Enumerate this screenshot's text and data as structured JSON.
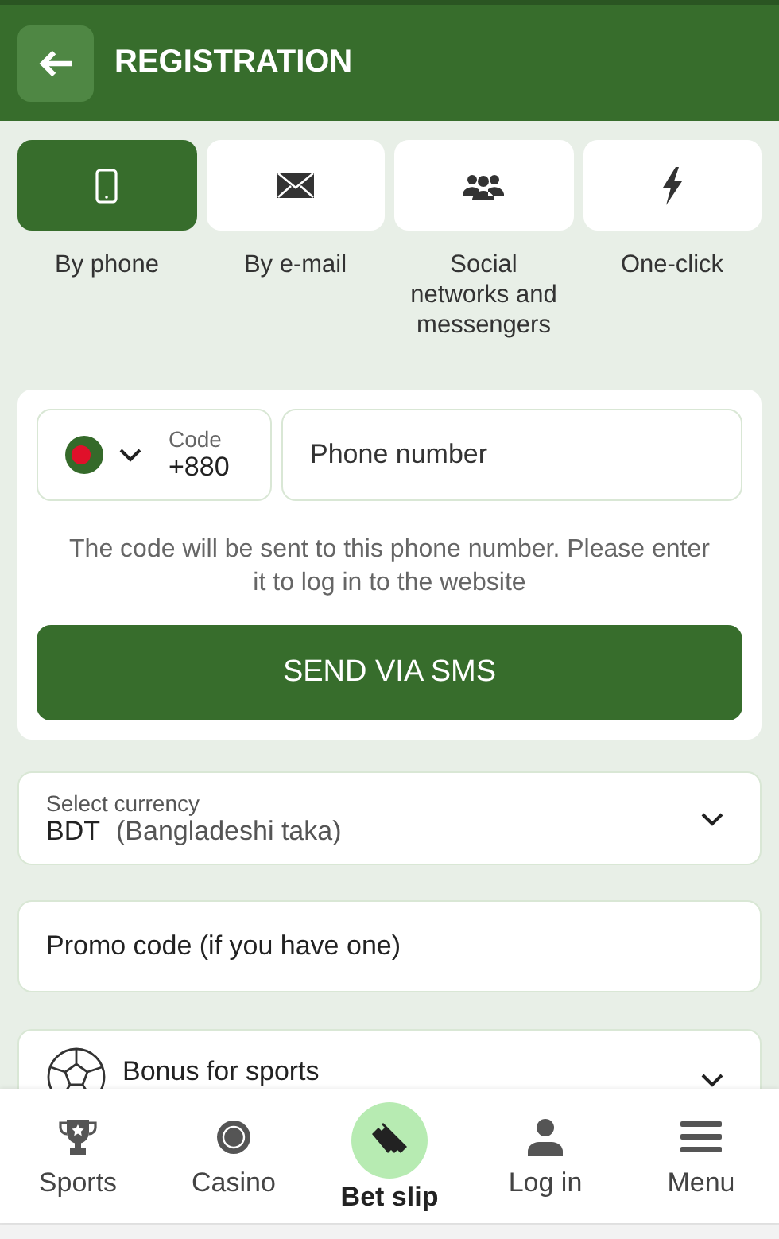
{
  "header": {
    "title": "REGISTRATION"
  },
  "tabs": [
    {
      "label": "By phone",
      "selected": true
    },
    {
      "label": "By e-mail",
      "selected": false
    },
    {
      "label": "Social networks and messengers",
      "selected": false
    },
    {
      "label": "One-click",
      "selected": false
    }
  ],
  "phone_form": {
    "code_label": "Code",
    "code_value": "+880",
    "phone_placeholder": "Phone number",
    "hint": "The code will be sent to this phone number. Please enter it to log in to the website",
    "button": "SEND VIA SMS"
  },
  "currency": {
    "label": "Select currency",
    "code": "BDT",
    "name": "(Bangladeshi taka)"
  },
  "promo": {
    "placeholder": "Promo code (if you have one)"
  },
  "bonus": {
    "title": "Bonus for sports"
  },
  "nav": [
    {
      "label": "Sports",
      "selected": false
    },
    {
      "label": "Casino",
      "selected": false
    },
    {
      "label": "Bet slip",
      "selected": true
    },
    {
      "label": "Log in",
      "selected": false
    },
    {
      "label": "Menu",
      "selected": false
    }
  ]
}
